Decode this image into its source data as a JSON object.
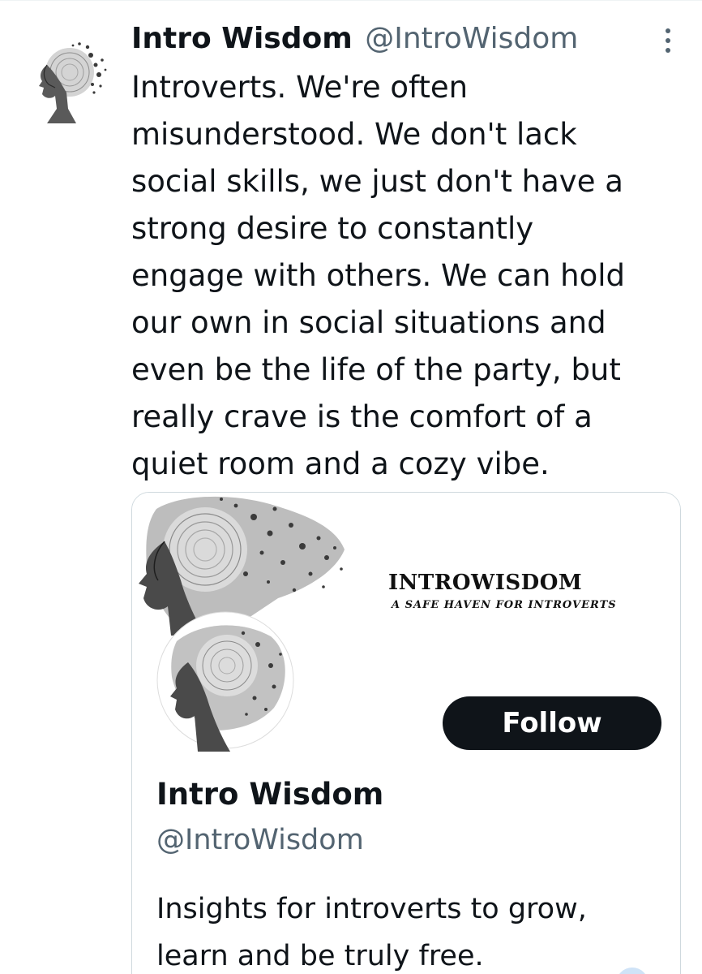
{
  "tweet": {
    "author_name": "Intro Wisdom",
    "author_handle": "@IntroWisdom",
    "text": "Introverts. We're often misunderstood. We don't lack social skills, we just don't have a strong desire to constantly engage with others. We can hold our own in social situations and even be the life of the party, but really crave is the comfort of a quiet room and a cozy vibe.",
    "text_lines": [
      "Introverts. We're often",
      "misunderstood. We don't lack",
      "social skills, we just don't have a",
      "strong desire to constantly",
      "engage with others. We can hold",
      "our own in social situations and",
      "even be the life of the party, but",
      "really crave is the comfort of a",
      "quiet room and a cozy vibe."
    ],
    "more_icon": "more-vertical-icon"
  },
  "profile_card": {
    "banner_title": "INTROWISDOM",
    "banner_tagline": "A SAFE HAVEN FOR INTROVERTS",
    "follow_label": "Follow",
    "name": "Intro Wisdom",
    "handle": "@IntroWisdom",
    "bio_lines": [
      "Insights for introverts to grow,",
      "learn and be truly free."
    ]
  },
  "colors": {
    "text_primary": "#0f1419",
    "text_secondary": "#536471",
    "border": "#cfd9de",
    "button_bg": "#0f1419",
    "button_text": "#ffffff"
  }
}
